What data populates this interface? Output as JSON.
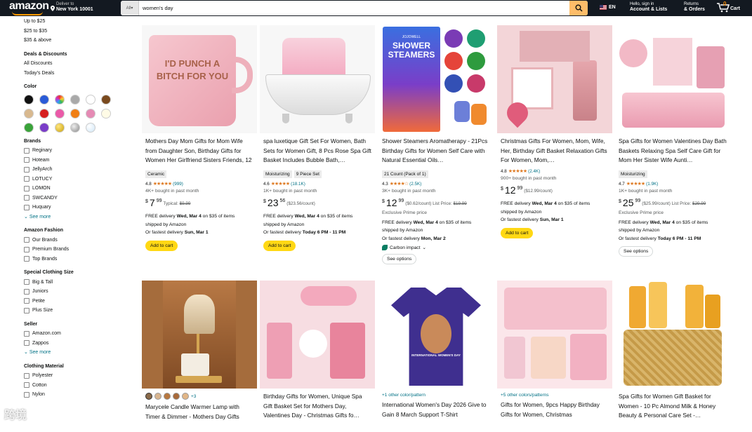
{
  "header": {
    "logo_text": "amazon",
    "deliver_line1": "Deliver to",
    "deliver_line2": "New York 10001",
    "search_category": "All",
    "search_value": "women's day",
    "language": "EN",
    "account_line1": "Hello, sign in",
    "account_line2": "Account & Lists",
    "returns_line1": "Returns",
    "returns_line2": "& Orders",
    "cart_count": "0",
    "cart_label": "Cart"
  },
  "sidebar": {
    "price_links": [
      "Up to $25",
      "$25 to $35",
      "$35 & above"
    ],
    "deals_title": "Deals & Discounts",
    "deals_links": [
      "All Discounts",
      "Today's Deals"
    ],
    "color_title": "Color",
    "colors": [
      "#111111",
      "#2a5bd7",
      "multicolor",
      "#a9a9a9",
      "#ffffff",
      "#7a4a1e",
      "#d8b98f",
      "#d61f1f",
      "#ea5aa8",
      "#f07f15",
      "#e58ab4",
      "#ffffff",
      "#3aa33a",
      "#7a3dc8",
      "gold",
      "silver",
      "clear"
    ],
    "brands_title": "Brands",
    "brands": [
      "Reginary",
      "Hoteam",
      "JellyArch",
      "LOTUCY",
      "LOMON",
      "SWCANDY",
      "Huquary"
    ],
    "see_more": "See more",
    "fashion_title": "Amazon Fashion",
    "fashion": [
      "Our Brands",
      "Premium Brands",
      "Top Brands"
    ],
    "size_title": "Special Clothing Size",
    "sizes": [
      "Big & Tall",
      "Juniors",
      "Petite",
      "Plus Size"
    ],
    "seller_title": "Seller",
    "sellers": [
      "Amazon.com",
      "Zappos"
    ],
    "see_more2": "See more",
    "material_title": "Clothing Material",
    "materials": [
      "Polyester",
      "Cotton",
      "Nylon"
    ]
  },
  "products": [
    {
      "title": "Mothers Day Mom Gifts for Mom Wife from Daughter Son, Birthday Gifts for Women Her Girlfriend Sisters Friends, 12 OZ Funny Coffee…",
      "badge": "Ceramic",
      "rating": "4.8",
      "reviews": "(999)",
      "bought": "4K+ bought in past month",
      "price_whole": "7",
      "price_frac": "99",
      "price_meta": "Typical: ",
      "price_strike": "$9.99",
      "delivery": "FREE delivery ",
      "delivery_date": "Wed, Mar 4",
      "delivery_tail": " on $35 of items",
      "shipped": "shipped by Amazon",
      "fastest": "Or fastest delivery ",
      "fastest_date": "Sun, Mar 1",
      "button": "Add to cart",
      "image_text": "I'D PUNCH A BITCH FOR YOU"
    },
    {
      "title": "spa luxetique Gift Set For Women, Bath Sets for Women Gift, 8 Pcs Rose Spa Gift Basket Includes Bubble Bath,…",
      "badge": "Moisturizing",
      "badge2": "9 Piece Set",
      "rating": "4.6",
      "reviews": "(18.1K)",
      "bought": "1K+ bought in past month",
      "price_whole": "23",
      "price_frac": "56",
      "price_meta": "($23.56/count)",
      "delivery": "FREE delivery ",
      "delivery_date": "Wed, Mar 4",
      "delivery_tail": " on $35 of items",
      "shipped": "shipped by Amazon",
      "fastest": "Or fastest delivery ",
      "fastest_date": "Today 6 PM - 11 PM",
      "button": "Add to cart"
    },
    {
      "title": "Shower Steamers Aromatherapy - 21Pcs Birthday Gifts for Women Self Care with Natural Essential Oils…",
      "badge": "21 Count (Pack of 1)",
      "rating": "4.3",
      "reviews": "(2.5K)",
      "bought": "3K+ bought in past month",
      "price_whole": "12",
      "price_frac": "99",
      "price_meta": "($0.62/count) List Price: ",
      "price_strike": "$19.99",
      "exclusive": "Exclusive Prime price",
      "delivery": "FREE delivery ",
      "delivery_date": "Wed, Mar 4",
      "delivery_tail": " on $35 of items",
      "shipped": "shipped by Amazon",
      "fastest": "Or fastest delivery ",
      "fastest_date": "Mon, Mar 2",
      "carbon": "Carbon impact",
      "button": "See options",
      "image_brand": "JOJOWELL",
      "image_text": "SHOWER STEAMERS"
    },
    {
      "title": "Christmas Gifts For Women, Mom, Wife, Her, Birthday Gift Basket Relaxation Gifts For Women, Mom,…",
      "rating": "4.8",
      "reviews": "(2.4K)",
      "bought": "900+ bought in past month",
      "price_whole": "12",
      "price_frac": "99",
      "price_meta": "($12.99/count)",
      "delivery": "FREE delivery ",
      "delivery_date": "Wed, Mar 4",
      "delivery_tail": " on $35 of items",
      "shipped": "shipped by Amazon",
      "fastest": "Or fastest delivery ",
      "fastest_date": "Sun, Mar 1",
      "button": "Add to cart"
    },
    {
      "title": "Spa Gifts for Women Valentines Day Bath Baskets Relaxing Spa Self Care Gift for Mom Her Sister Wife Aunti…",
      "badge": "Moisturizing",
      "rating": "4.7",
      "reviews": "(1.9K)",
      "bought": "1K+ bought in past month",
      "price_whole": "25",
      "price_frac": "99",
      "price_meta": "($25.99/count) List Price: ",
      "price_strike": "$29.99",
      "exclusive": "Exclusive Prime price",
      "delivery": "FREE delivery ",
      "delivery_date": "Wed, Mar 4",
      "delivery_tail": " on $35 of items",
      "shipped": "shipped by Amazon",
      "fastest": "Or fastest delivery ",
      "fastest_date": "Today 6 PM - 11 PM",
      "button": "See options"
    }
  ],
  "products_row2": [
    {
      "title": "Marycele Candle Warmer Lamp with Timer & Dimmer - Mothers Day Gifts",
      "more_colors": "+3"
    },
    {
      "title": "Birthday Gifts for Women, Unique Spa Gift Basket Set for Mothers Day, Valentines Day - Christmas Gifts fo…"
    },
    {
      "title": "International Women's Day 2026 Give to Gain 8 March Support T-Shirt",
      "colors_link": "+1 other color/pattern",
      "shirt_text": "INTERNATIONAL WOMEN'S DAY"
    },
    {
      "title": "Gifts for Women, 9pcs Happy Birthday Gifts for Women, Christmas",
      "colors_link": "+5 other colors/patterns"
    },
    {
      "title": "Spa Gifts for Women Gift Basket for Women - 10 Pc Almond Milk & Honey Beauty & Personal Care Set -…"
    }
  ],
  "watermark": "跨境"
}
